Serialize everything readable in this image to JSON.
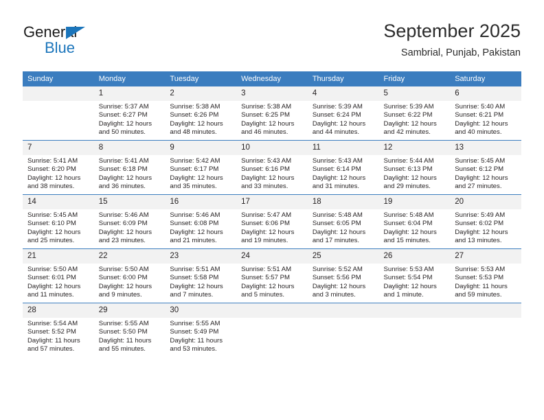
{
  "brand": {
    "name_top": "General",
    "name_bottom": "Blue",
    "accent_color": "#1b75bb",
    "triangle_icon": "triangle-icon"
  },
  "header": {
    "month_title": "September 2025",
    "location": "Sambrial, Punjab, Pakistan"
  },
  "calendar": {
    "header_bg": "#3b7dbf",
    "daynum_bg": "#f2f2f2",
    "weekday_headers": [
      "Sunday",
      "Monday",
      "Tuesday",
      "Wednesday",
      "Thursday",
      "Friday",
      "Saturday"
    ],
    "weeks": [
      [
        {
          "day": "",
          "sunrise": "",
          "sunset": "",
          "daylight_line1": "",
          "daylight_line2": "",
          "empty": true
        },
        {
          "day": "1",
          "sunrise": "Sunrise: 5:37 AM",
          "sunset": "Sunset: 6:27 PM",
          "daylight_line1": "Daylight: 12 hours",
          "daylight_line2": "and 50 minutes."
        },
        {
          "day": "2",
          "sunrise": "Sunrise: 5:38 AM",
          "sunset": "Sunset: 6:26 PM",
          "daylight_line1": "Daylight: 12 hours",
          "daylight_line2": "and 48 minutes."
        },
        {
          "day": "3",
          "sunrise": "Sunrise: 5:38 AM",
          "sunset": "Sunset: 6:25 PM",
          "daylight_line1": "Daylight: 12 hours",
          "daylight_line2": "and 46 minutes."
        },
        {
          "day": "4",
          "sunrise": "Sunrise: 5:39 AM",
          "sunset": "Sunset: 6:24 PM",
          "daylight_line1": "Daylight: 12 hours",
          "daylight_line2": "and 44 minutes."
        },
        {
          "day": "5",
          "sunrise": "Sunrise: 5:39 AM",
          "sunset": "Sunset: 6:22 PM",
          "daylight_line1": "Daylight: 12 hours",
          "daylight_line2": "and 42 minutes."
        },
        {
          "day": "6",
          "sunrise": "Sunrise: 5:40 AM",
          "sunset": "Sunset: 6:21 PM",
          "daylight_line1": "Daylight: 12 hours",
          "daylight_line2": "and 40 minutes."
        }
      ],
      [
        {
          "day": "7",
          "sunrise": "Sunrise: 5:41 AM",
          "sunset": "Sunset: 6:20 PM",
          "daylight_line1": "Daylight: 12 hours",
          "daylight_line2": "and 38 minutes."
        },
        {
          "day": "8",
          "sunrise": "Sunrise: 5:41 AM",
          "sunset": "Sunset: 6:18 PM",
          "daylight_line1": "Daylight: 12 hours",
          "daylight_line2": "and 36 minutes."
        },
        {
          "day": "9",
          "sunrise": "Sunrise: 5:42 AM",
          "sunset": "Sunset: 6:17 PM",
          "daylight_line1": "Daylight: 12 hours",
          "daylight_line2": "and 35 minutes."
        },
        {
          "day": "10",
          "sunrise": "Sunrise: 5:43 AM",
          "sunset": "Sunset: 6:16 PM",
          "daylight_line1": "Daylight: 12 hours",
          "daylight_line2": "and 33 minutes."
        },
        {
          "day": "11",
          "sunrise": "Sunrise: 5:43 AM",
          "sunset": "Sunset: 6:14 PM",
          "daylight_line1": "Daylight: 12 hours",
          "daylight_line2": "and 31 minutes."
        },
        {
          "day": "12",
          "sunrise": "Sunrise: 5:44 AM",
          "sunset": "Sunset: 6:13 PM",
          "daylight_line1": "Daylight: 12 hours",
          "daylight_line2": "and 29 minutes."
        },
        {
          "day": "13",
          "sunrise": "Sunrise: 5:45 AM",
          "sunset": "Sunset: 6:12 PM",
          "daylight_line1": "Daylight: 12 hours",
          "daylight_line2": "and 27 minutes."
        }
      ],
      [
        {
          "day": "14",
          "sunrise": "Sunrise: 5:45 AM",
          "sunset": "Sunset: 6:10 PM",
          "daylight_line1": "Daylight: 12 hours",
          "daylight_line2": "and 25 minutes."
        },
        {
          "day": "15",
          "sunrise": "Sunrise: 5:46 AM",
          "sunset": "Sunset: 6:09 PM",
          "daylight_line1": "Daylight: 12 hours",
          "daylight_line2": "and 23 minutes."
        },
        {
          "day": "16",
          "sunrise": "Sunrise: 5:46 AM",
          "sunset": "Sunset: 6:08 PM",
          "daylight_line1": "Daylight: 12 hours",
          "daylight_line2": "and 21 minutes."
        },
        {
          "day": "17",
          "sunrise": "Sunrise: 5:47 AM",
          "sunset": "Sunset: 6:06 PM",
          "daylight_line1": "Daylight: 12 hours",
          "daylight_line2": "and 19 minutes."
        },
        {
          "day": "18",
          "sunrise": "Sunrise: 5:48 AM",
          "sunset": "Sunset: 6:05 PM",
          "daylight_line1": "Daylight: 12 hours",
          "daylight_line2": "and 17 minutes."
        },
        {
          "day": "19",
          "sunrise": "Sunrise: 5:48 AM",
          "sunset": "Sunset: 6:04 PM",
          "daylight_line1": "Daylight: 12 hours",
          "daylight_line2": "and 15 minutes."
        },
        {
          "day": "20",
          "sunrise": "Sunrise: 5:49 AM",
          "sunset": "Sunset: 6:02 PM",
          "daylight_line1": "Daylight: 12 hours",
          "daylight_line2": "and 13 minutes."
        }
      ],
      [
        {
          "day": "21",
          "sunrise": "Sunrise: 5:50 AM",
          "sunset": "Sunset: 6:01 PM",
          "daylight_line1": "Daylight: 12 hours",
          "daylight_line2": "and 11 minutes."
        },
        {
          "day": "22",
          "sunrise": "Sunrise: 5:50 AM",
          "sunset": "Sunset: 6:00 PM",
          "daylight_line1": "Daylight: 12 hours",
          "daylight_line2": "and 9 minutes."
        },
        {
          "day": "23",
          "sunrise": "Sunrise: 5:51 AM",
          "sunset": "Sunset: 5:58 PM",
          "daylight_line1": "Daylight: 12 hours",
          "daylight_line2": "and 7 minutes."
        },
        {
          "day": "24",
          "sunrise": "Sunrise: 5:51 AM",
          "sunset": "Sunset: 5:57 PM",
          "daylight_line1": "Daylight: 12 hours",
          "daylight_line2": "and 5 minutes."
        },
        {
          "day": "25",
          "sunrise": "Sunrise: 5:52 AM",
          "sunset": "Sunset: 5:56 PM",
          "daylight_line1": "Daylight: 12 hours",
          "daylight_line2": "and 3 minutes."
        },
        {
          "day": "26",
          "sunrise": "Sunrise: 5:53 AM",
          "sunset": "Sunset: 5:54 PM",
          "daylight_line1": "Daylight: 12 hours",
          "daylight_line2": "and 1 minute."
        },
        {
          "day": "27",
          "sunrise": "Sunrise: 5:53 AM",
          "sunset": "Sunset: 5:53 PM",
          "daylight_line1": "Daylight: 11 hours",
          "daylight_line2": "and 59 minutes."
        }
      ],
      [
        {
          "day": "28",
          "sunrise": "Sunrise: 5:54 AM",
          "sunset": "Sunset: 5:52 PM",
          "daylight_line1": "Daylight: 11 hours",
          "daylight_line2": "and 57 minutes."
        },
        {
          "day": "29",
          "sunrise": "Sunrise: 5:55 AM",
          "sunset": "Sunset: 5:50 PM",
          "daylight_line1": "Daylight: 11 hours",
          "daylight_line2": "and 55 minutes."
        },
        {
          "day": "30",
          "sunrise": "Sunrise: 5:55 AM",
          "sunset": "Sunset: 5:49 PM",
          "daylight_line1": "Daylight: 11 hours",
          "daylight_line2": "and 53 minutes."
        },
        {
          "day": "",
          "sunrise": "",
          "sunset": "",
          "daylight_line1": "",
          "daylight_line2": "",
          "empty": true
        },
        {
          "day": "",
          "sunrise": "",
          "sunset": "",
          "daylight_line1": "",
          "daylight_line2": "",
          "empty": true
        },
        {
          "day": "",
          "sunrise": "",
          "sunset": "",
          "daylight_line1": "",
          "daylight_line2": "",
          "empty": true
        },
        {
          "day": "",
          "sunrise": "",
          "sunset": "",
          "daylight_line1": "",
          "daylight_line2": "",
          "empty": true
        }
      ]
    ]
  }
}
